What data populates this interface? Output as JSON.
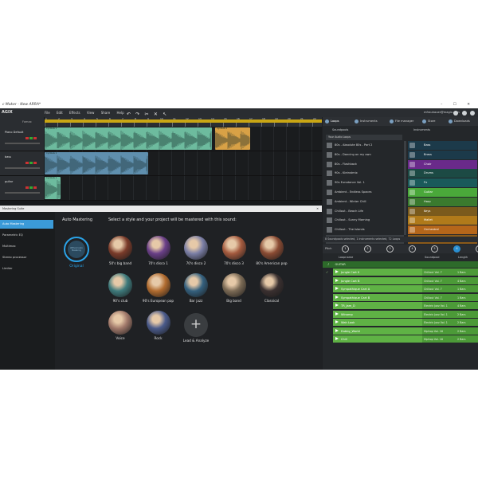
{
  "window": {
    "title": "c Maker - New ARRA*",
    "controls": "–  ☐  ✕"
  },
  "menubar": {
    "logo": "AGIX",
    "menus": [
      "File",
      "Edit",
      "Effects",
      "View",
      "Share",
      "Help"
    ],
    "toolbar_icons": [
      "undo-icon",
      "redo-icon",
      "cut-icon",
      "scissors-icon",
      "pointer-icon"
    ],
    "user_email": "mfrauhauer@magix.com"
  },
  "arrangement": {
    "header_label": "Fomax",
    "ruler_numbers": [
      "1",
      "2",
      "3",
      "4",
      "5",
      "6",
      "7",
      "8",
      "9",
      "10",
      "11",
      "12",
      "13",
      "14",
      "15",
      "16",
      "17",
      "18",
      "19",
      "20",
      "21",
      "22"
    ],
    "tracks": [
      {
        "name": "Piano Default",
        "clip_color": "green"
      },
      {
        "name": "bass",
        "clip_color": "blue"
      },
      {
        "name": "guitar",
        "clip_color": "green"
      }
    ],
    "clip_caption": "Cymbals 1"
  },
  "mastering": {
    "window_title": "Mastering Suite",
    "close": "✕",
    "sidebar": [
      "Auto Mastering",
      "Parametric EQ",
      "Multimax",
      "Stereo processor",
      "Limiter"
    ],
    "active_item": "Auto Mastering",
    "heading": "Auto Mastering",
    "instruction": "Select a style and your project will be mastered with this sound:",
    "original": {
      "label": "Original",
      "inner": "Without Auto Mastering"
    },
    "styles": [
      {
        "label": "50's big band",
        "color": "#7a3b2a"
      },
      {
        "label": "70's disco 1",
        "color": "#6a3f88"
      },
      {
        "label": "70's disco 2",
        "color": "#7b7fa6"
      },
      {
        "label": "70's disco 3",
        "color": "#a45a3e"
      },
      {
        "label": "80's American pop",
        "color": "#8a4b33"
      },
      {
        "label": "90's club",
        "color": "#3e7a7c"
      },
      {
        "label": "90's European pop",
        "color": "#b06b2f"
      },
      {
        "label": "Bar jazz",
        "color": "#34607e"
      },
      {
        "label": "Big band",
        "color": "#7b6a55"
      },
      {
        "label": "Classical",
        "color": "#3a3030"
      },
      {
        "label": "Voice",
        "color": "#a0786a"
      },
      {
        "label": "Rock",
        "color": "#4a5a8a"
      }
    ],
    "lead_analyze": "Lead & Analyze"
  },
  "right_panel": {
    "tabs": [
      "Loops",
      "Instruments",
      "File manager",
      "Store",
      "Downloads"
    ],
    "soundpools_header": "Soundpools",
    "instruments_header": "Instruments",
    "filter": "Your Audio Loops",
    "soundpools": [
      "80s - Absolute 80s - Part 2",
      "80s - Dancing on my own",
      "80s - Flashback",
      "90s - Kleinstmix",
      "90s Eurodance Vol. 1",
      "Ambient - Endless Spaces",
      "Ambient - Winter Chill",
      "Chillout - Beach Life",
      "Chillout - Sunny Morning",
      "Chillout - The Islands",
      "Chillout Vol. 7"
    ],
    "instruments": [
      {
        "name": "Bass",
        "color": "#1c3a4a"
      },
      {
        "name": "Brass",
        "color": "#1c3a4a"
      },
      {
        "name": "Choir",
        "color": "#6a2a8a"
      },
      {
        "name": "Drums",
        "color": "#1c4a44"
      },
      {
        "name": "Fx",
        "color": "#1a5a5a"
      },
      {
        "name": "Guitar",
        "color": "#4aa83a"
      },
      {
        "name": "Harp",
        "color": "#3a7a2e"
      },
      {
        "name": "Keys",
        "color": "#7a5a1c"
      },
      {
        "name": "Mallet",
        "color": "#b07a1a"
      },
      {
        "name": "Orchestral",
        "color": "#b5661a"
      },
      {
        "name": "Pads",
        "color": "#8a5a1a"
      }
    ],
    "summary": "8 Soundpools selected, 1 instruments selected, 72 Loops",
    "pick_label": "Pitch",
    "pick_numbers": [
      "1",
      "2",
      "3",
      "4",
      "5",
      "6",
      "7"
    ],
    "active_pick": "6",
    "loop_headers": [
      "Loopname",
      "Soundpool",
      "Length"
    ],
    "category": "GUITAR",
    "loops": [
      {
        "name": "Jungle Cart II",
        "pool": "Chillout Vol. 7",
        "len": "1 Bars"
      },
      {
        "name": "Jungle Cart B",
        "pool": "Chillout Vol. 7",
        "len": "4 Bars"
      },
      {
        "name": "Sympathique Cart A",
        "pool": "Chillout Vol. 7",
        "len": "1 Bars"
      },
      {
        "name": "Sympathique Cart B",
        "pool": "Chillout Vol. 7",
        "len": "1 Bars"
      },
      {
        "name": "TR_Jam_D",
        "pool": "Electric Jazz Vol. 1",
        "len": "4 Bars"
      },
      {
        "name": "Winamp",
        "pool": "Electric Jazz Vol. 1",
        "len": "2 Bars"
      },
      {
        "name": "Wah Look",
        "pool": "Electric Jazz Vol. 1",
        "len": "2 Bars"
      },
      {
        "name": "Dubby_World",
        "pool": "Hiphop Vol. 16",
        "len": "2 Bars"
      },
      {
        "name": "Chill",
        "pool": "Hiphop Vol. 16",
        "len": "2 Bars"
      }
    ]
  }
}
